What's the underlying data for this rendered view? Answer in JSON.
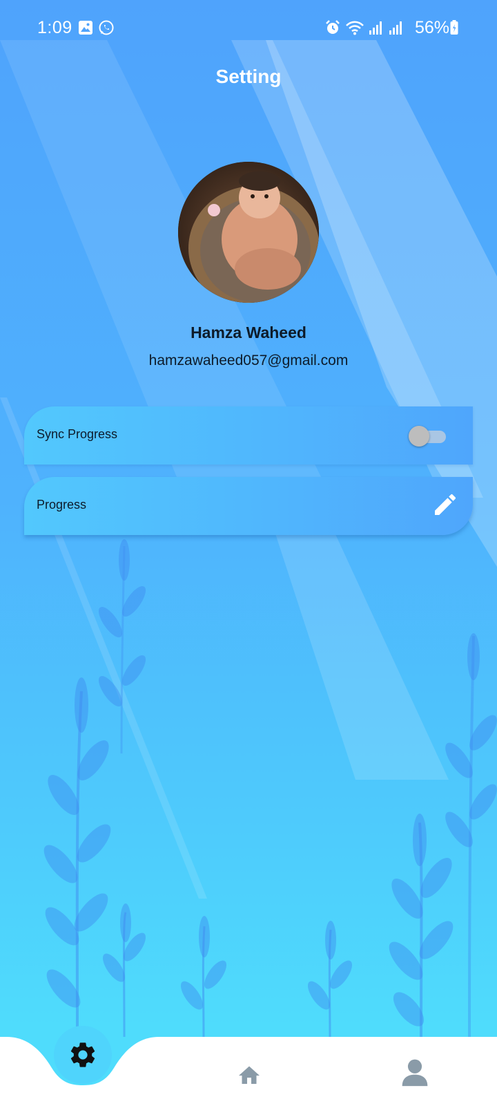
{
  "status_bar": {
    "time": "1:09",
    "battery": "56%",
    "icons": [
      "gallery-icon",
      "whatsapp-icon",
      "alarm-icon",
      "wifi-icon",
      "signal-icon",
      "signal-icon",
      "battery-icon"
    ]
  },
  "header": {
    "title": "Setting"
  },
  "profile": {
    "name": "Hamza Waheed",
    "email": "hamzawaheed057@gmail.com",
    "avatar_icon": "profile-photo"
  },
  "settings": {
    "sync": {
      "label": "Sync Progress",
      "enabled": false
    },
    "progress": {
      "label": "Progress",
      "action_icon": "pencil-icon"
    }
  },
  "bottom_nav": {
    "items": [
      "gear-icon",
      "home-icon",
      "person-icon"
    ],
    "active": "gear-icon"
  },
  "colors": {
    "accent": "#4fa3fc",
    "nav_active": "#4fd4fc",
    "nav_inactive": "#8a9ba8"
  }
}
